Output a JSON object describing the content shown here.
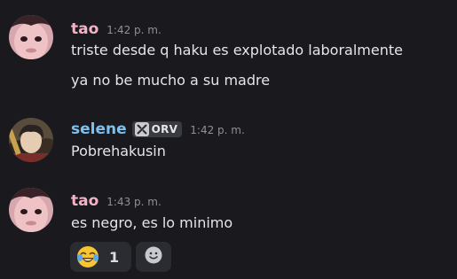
{
  "messages": [
    {
      "author": "tao",
      "time": "1:42 p. m.",
      "lines": [
        "triste desde q haku es explotado laboralmente",
        "ya no be mucho a su madre"
      ],
      "name_color": "#f2b3c6"
    },
    {
      "author": "selene",
      "time": "1:42 p. m.",
      "tag": {
        "label": "ORV",
        "icon": "crossed-swords-icon"
      },
      "lines": [
        "Pobrehakusin"
      ],
      "name_color": "#7dc1ee"
    },
    {
      "author": "tao",
      "time": "1:43 p. m.",
      "lines": [
        "es negro, es lo minimo"
      ],
      "name_color": "#f2b3c6",
      "reactions": [
        {
          "emoji": "joy-emoji-icon",
          "count": "1"
        }
      ],
      "add_reaction_icon": "add-reaction-icon"
    }
  ]
}
